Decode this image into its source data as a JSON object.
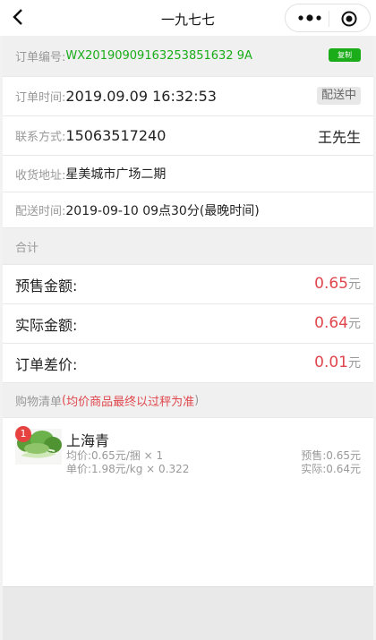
{
  "nav": {
    "title": "一九七七"
  },
  "order": {
    "number_label": "订单编号:",
    "number_value": "WX20190909163253851632 9A",
    "copy_label": "复制",
    "time_label": "订单时间:",
    "time_value": "2019.09.09 16:32:53",
    "status": "配送中",
    "contact_label": "联系方式:",
    "contact_value": "15063517240",
    "contact_name": "王先生",
    "address_label": "收货地址:",
    "address_value": "星美城市广场二期",
    "delivery_label": "配送时间:",
    "delivery_value": "2019-09-10 09点30分(最晚时间)"
  },
  "totals": {
    "header": "合计",
    "rows": [
      {
        "label": "预售金额:",
        "amount": "0.65",
        "unit": "元"
      },
      {
        "label": "实际金额:",
        "amount": "0.64",
        "unit": "元"
      },
      {
        "label": "订单差价:",
        "amount": "0.01",
        "unit": "元"
      }
    ]
  },
  "shopping": {
    "header": "购物清单",
    "note_open": "(",
    "note": " 均价商品最终以过秤为准 ",
    "note_close": ")"
  },
  "items": [
    {
      "badge": "1",
      "name": "上海青",
      "avg_price": "均价:0.65元/捆 × 1",
      "unit_price": "单价:1.98元/kg × 0.322",
      "presale": "预售:0.65元",
      "actual": "实际:0.64元"
    }
  ],
  "colors": {
    "accent_green": "#1aad19",
    "price_red": "#e0474c",
    "badge_red": "#e64340"
  }
}
